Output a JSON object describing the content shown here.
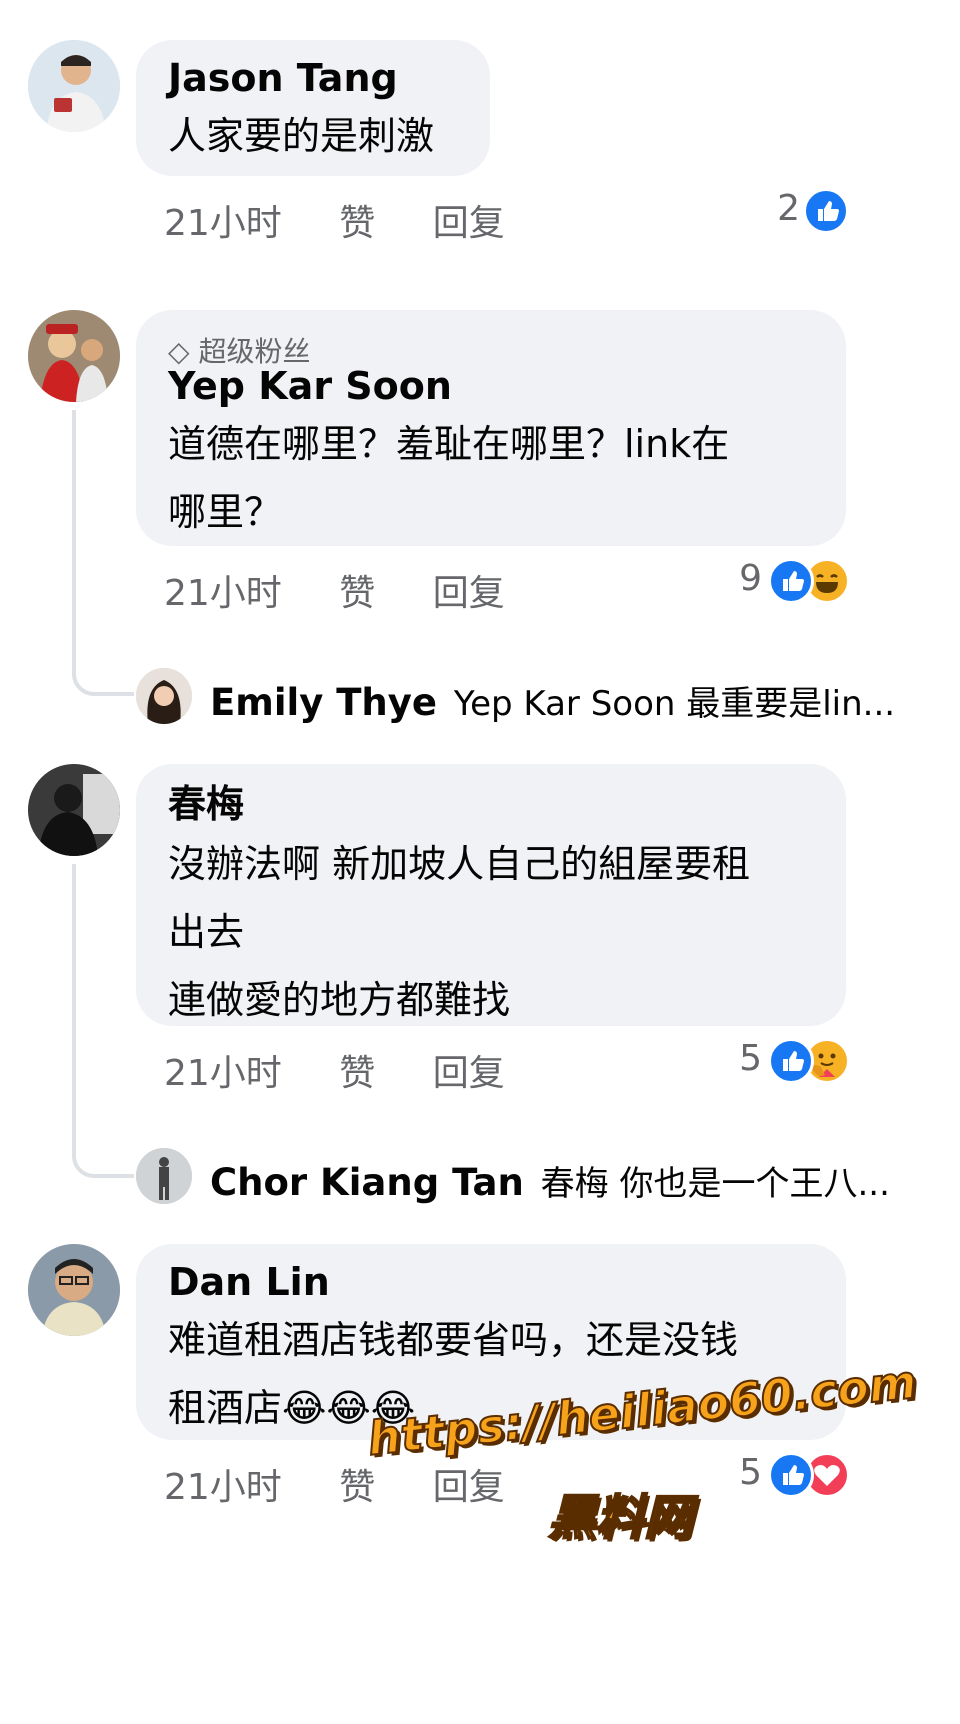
{
  "comments": [
    {
      "name": "Jason Tang",
      "lines": [
        "人家要的是刺激"
      ],
      "time": "21小时",
      "like": "赞",
      "reply": "回复",
      "count": "2",
      "reactions": [
        "like"
      ]
    },
    {
      "badge": "超级粉丝",
      "name": "Yep Kar Soon",
      "lines": [
        "道德在哪里？羞耻在哪里？link在",
        "哪里？"
      ],
      "time": "21小时",
      "like": "赞",
      "reply": "回复",
      "count": "9",
      "reactions": [
        "like",
        "haha"
      ],
      "reply_preview": {
        "name": "Emily Thye",
        "text": "Yep Kar Soon 最重要是lin..."
      }
    },
    {
      "name": "春梅",
      "lines": [
        "沒辦法啊 新加坡人自己的組屋要租",
        "出去",
        "連做愛的地方都難找"
      ],
      "time": "21小时",
      "like": "赞",
      "reply": "回复",
      "count": "5",
      "reactions": [
        "like",
        "care"
      ],
      "reply_preview": {
        "name": "Chor Kiang Tan",
        "text": "春梅 你也是一个王八..."
      }
    },
    {
      "name": "Dan Lin",
      "lines": [
        "难道租酒店钱都要省吗，还是没钱",
        "租酒店😂😂😂"
      ],
      "time": "21小时",
      "like": "赞",
      "reply": "回复",
      "count": "5",
      "reactions": [
        "like",
        "love"
      ]
    }
  ],
  "watermark": {
    "line1": "https://heiliao60.com",
    "line2": "黑料网"
  },
  "colors": {
    "like": "#1877f2",
    "haha": "#f7b125",
    "love": "#f33e58",
    "bubble": "#f0f2f5",
    "meta": "#65676b",
    "watermark": "#f7a21b"
  }
}
